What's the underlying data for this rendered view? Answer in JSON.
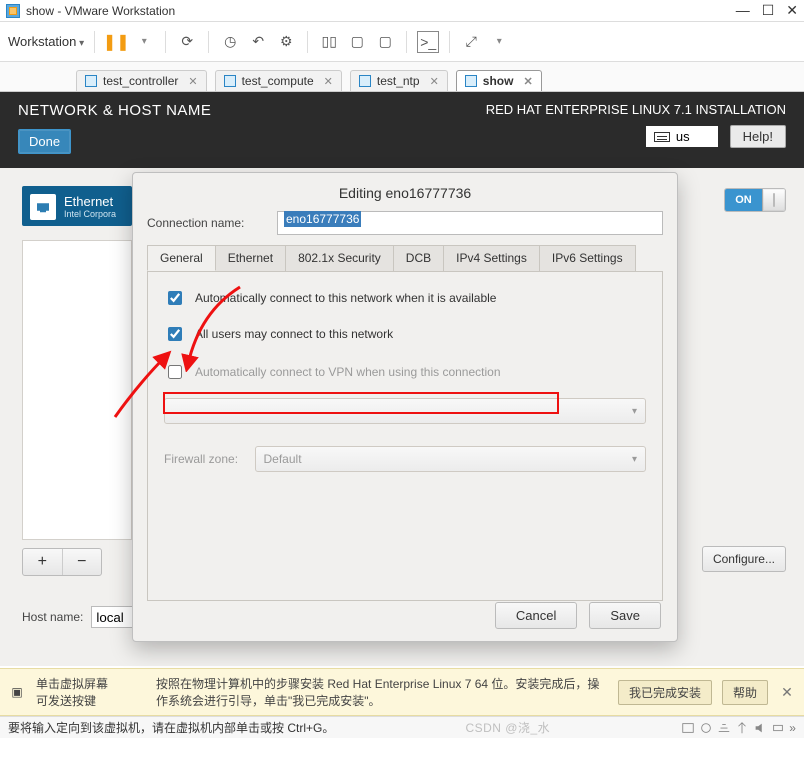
{
  "window": {
    "title": "show - VMware Workstation"
  },
  "menu": {
    "workstation": "Workstation"
  },
  "vm_tabs": [
    {
      "label": "test_controller",
      "active": false
    },
    {
      "label": "test_compute",
      "active": false
    },
    {
      "label": "test_ntp",
      "active": false
    },
    {
      "label": "show",
      "active": true
    }
  ],
  "guest": {
    "heading": "NETWORK & HOST NAME",
    "done": "Done",
    "product": "RED HAT ENTERPRISE LINUX 7.1 INSTALLATION",
    "kb": "us",
    "help": "Help!",
    "nic_title": "Ethernet",
    "nic_sub": "Intel Corpora",
    "toggle_on": "ON",
    "configure": "Configure...",
    "hostname_label": "Host name:",
    "hostname_value": "local",
    "plus": "+",
    "minus": "−"
  },
  "dialog": {
    "title": "Editing eno16777736",
    "conn_label": "Connection name:",
    "conn_value": "eno16777736",
    "tabs": [
      "General",
      "Ethernet",
      "802.1x Security",
      "DCB",
      "IPv4 Settings",
      "IPv6 Settings"
    ],
    "active_tab": 0,
    "chk_auto": "Automatically connect to this network when it is available",
    "chk_allusers": "All users may connect to this network",
    "chk_vpn": "Automatically connect to VPN when using this connection",
    "firewall_label": "Firewall zone:",
    "firewall_value": "Default",
    "cancel": "Cancel",
    "save": "Save"
  },
  "hint": {
    "left": "单击虚拟屏幕\n可发送按键",
    "mid": "按照在物理计算机中的步骤安装 Red Hat Enterprise Linux 7 64 位。安装完成后，操作系统会进行引导，单击\"我已完成安装\"。",
    "btn1": "我已完成安装",
    "btn2": "帮助"
  },
  "status": {
    "text": "要将输入定向到该虚拟机，请在虚拟机内部单击或按 Ctrl+G。",
    "watermark": "CSDN @浇_水"
  }
}
